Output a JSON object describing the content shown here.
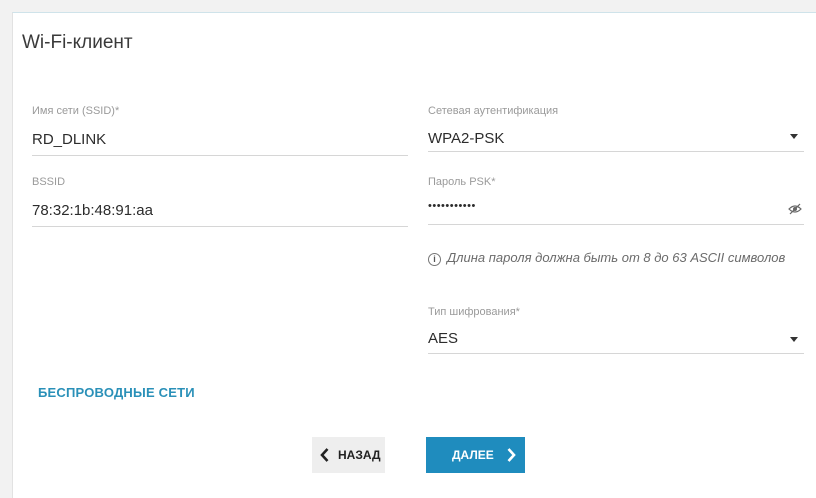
{
  "page": {
    "title": "Wi-Fi-клиент"
  },
  "fields": {
    "ssid": {
      "label": "Имя сети (SSID)*",
      "value": "RD_DLINK"
    },
    "bssid": {
      "label": "BSSID",
      "value": "78:32:1b:48:91:aa"
    },
    "auth": {
      "label": "Сетевая аутентификация",
      "value": "WPA2-PSK"
    },
    "psk": {
      "label": "Пароль PSK*",
      "value": "•••••••••••"
    },
    "encryption": {
      "label": "Тип шифрования*",
      "value": "AES"
    }
  },
  "note": {
    "text": "Длина пароля должна быть от 8 до 63 ASCII символов"
  },
  "links": {
    "wireless_networks": "БЕСПРОВОДНЫЕ СЕТИ"
  },
  "buttons": {
    "back": "НАЗАД",
    "next": "ДАЛЕЕ"
  },
  "icons": {
    "psk_visibility": "eye-hidden-icon",
    "info": "info-icon",
    "dropdown": "chevron-down-icon",
    "back": "chevron-left-icon",
    "next": "chevron-right-icon"
  },
  "colors": {
    "accent": "#1f8cbe",
    "link": "#2a90b8",
    "back_button_bg": "#eeeeee"
  }
}
